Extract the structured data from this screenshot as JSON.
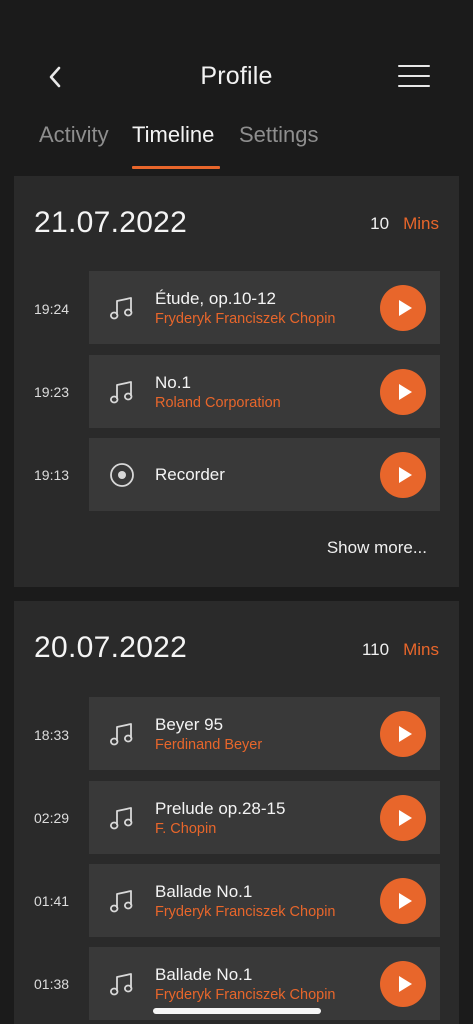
{
  "header": {
    "title": "Profile"
  },
  "tabs": [
    {
      "label": "Activity",
      "active": false
    },
    {
      "label": "Timeline",
      "active": true
    },
    {
      "label": "Settings",
      "active": false
    }
  ],
  "colors": {
    "accent": "#e8662b",
    "background": "#1b1b1b",
    "card": "#2a2a2a",
    "item": "#393939"
  },
  "days": [
    {
      "date": "21.07.2022",
      "minutes": "10",
      "minutes_unit": "Mins",
      "entries": [
        {
          "time": "19:24",
          "icon": "music-note-icon",
          "title": "Étude, op.10-12",
          "subtitle": "Fryderyk Franciszek Chopin"
        },
        {
          "time": "19:23",
          "icon": "music-note-icon",
          "title": "No.1",
          "subtitle": "Roland Corporation"
        },
        {
          "time": "19:13",
          "icon": "record-icon",
          "title": "Recorder",
          "subtitle": ""
        }
      ],
      "show_more": "Show more..."
    },
    {
      "date": "20.07.2022",
      "minutes": "110",
      "minutes_unit": "Mins",
      "entries": [
        {
          "time": "18:33",
          "icon": "music-note-icon",
          "title": "Beyer 95",
          "subtitle": "Ferdinand Beyer"
        },
        {
          "time": "02:29",
          "icon": "music-note-icon",
          "title": "Prelude op.28-15",
          "subtitle": "F. Chopin"
        },
        {
          "time": "01:41",
          "icon": "music-note-icon",
          "title": "Ballade No.1",
          "subtitle": "Fryderyk Franciszek Chopin"
        },
        {
          "time": "01:38",
          "icon": "music-note-icon",
          "title": "Ballade No.1",
          "subtitle": "Fryderyk Franciszek Chopin"
        }
      ]
    }
  ]
}
